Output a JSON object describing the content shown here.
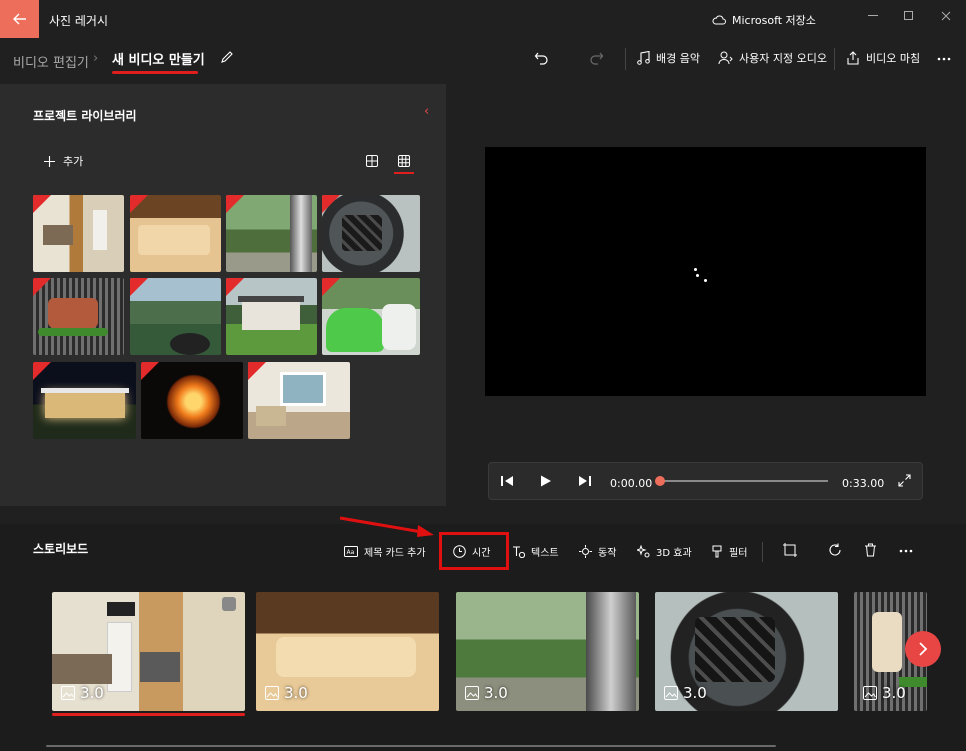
{
  "app": {
    "title": "사진 레거시",
    "cloud_label": "Microsoft 저장소"
  },
  "breadcrumb": {
    "parent": "비디오 편집기",
    "current": "새 비디오 만들기"
  },
  "toolbar": {
    "background_music": "배경 음악",
    "custom_audio": "사용자 지정 오디오",
    "finish_video": "비디오 마침"
  },
  "library": {
    "title": "프로젝트 라이브러리",
    "add_label": "추가"
  },
  "player": {
    "current_time": "0:00.00",
    "total_time": "0:33.00",
    "progress": 0
  },
  "storyboard": {
    "title": "스토리보드",
    "add_title_card": "제목 카드 추가",
    "duration": "시간",
    "text": "텍스트",
    "motion": "동작",
    "effects_3d": "3D 효과",
    "filter": "필터",
    "clips": [
      {
        "duration": "3.0"
      },
      {
        "duration": "3.0"
      },
      {
        "duration": "3.0"
      },
      {
        "duration": "3.0"
      },
      {
        "duration": "3.0"
      }
    ]
  },
  "colors": {
    "accent": "#ee6e5c",
    "highlight": "#e01010"
  }
}
